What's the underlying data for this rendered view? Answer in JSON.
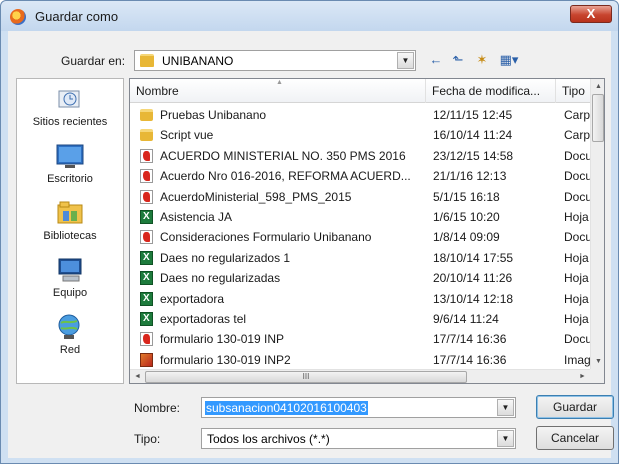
{
  "window": {
    "title": "Guardar como",
    "close_glyph": "X"
  },
  "location": {
    "label": "Guardar en:",
    "value": "UNIBANANO"
  },
  "toolbar": {
    "back_glyph": "←",
    "up_glyph": "⬑",
    "newfolder_glyph": "✶",
    "views_glyph": "▦▾"
  },
  "places": [
    {
      "label": "Sitios recientes",
      "icon": "recent-places-icon"
    },
    {
      "label": "Escritorio",
      "icon": "desktop-icon"
    },
    {
      "label": "Bibliotecas",
      "icon": "libraries-icon"
    },
    {
      "label": "Equipo",
      "icon": "computer-icon"
    },
    {
      "label": "Red",
      "icon": "network-icon"
    }
  ],
  "columns": {
    "name": "Nombre",
    "date": "Fecha de modifica...",
    "type": "Tipo"
  },
  "files": [
    {
      "name": "Pruebas Unibanano",
      "date": "12/11/15 12:45",
      "type": "Carpet",
      "icon": "folder"
    },
    {
      "name": "Script vue",
      "date": "16/10/14 11:24",
      "type": "Carpet",
      "icon": "folder"
    },
    {
      "name": "ACUERDO MINISTERIAL NO. 350 PMS 2016",
      "date": "23/12/15 14:58",
      "type": "Docun",
      "icon": "pdf"
    },
    {
      "name": "Acuerdo Nro  016-2016, REFORMA ACUERD...",
      "date": "21/1/16 12:13",
      "type": "Docun",
      "icon": "pdf"
    },
    {
      "name": "AcuerdoMinisterial_598_PMS_2015",
      "date": "5/1/15 16:18",
      "type": "Docun",
      "icon": "pdf"
    },
    {
      "name": "Asistencia JA",
      "date": "1/6/15 10:20",
      "type": "Hoja d",
      "icon": "xls"
    },
    {
      "name": "Consideraciones Formulario Unibanano",
      "date": "1/8/14 09:09",
      "type": "Docun",
      "icon": "pdf"
    },
    {
      "name": "Daes no regularizados 1",
      "date": "18/10/14 17:55",
      "type": "Hoja d",
      "icon": "xls"
    },
    {
      "name": "Daes no regularizadas",
      "date": "20/10/14 11:26",
      "type": "Hoja d",
      "icon": "xls"
    },
    {
      "name": "exportadora",
      "date": "13/10/14 12:18",
      "type": "Hoja d",
      "icon": "xls"
    },
    {
      "name": "exportadoras tel",
      "date": "9/6/14 11:24",
      "type": "Hoja d",
      "icon": "xls"
    },
    {
      "name": "formulario 130-019 INP",
      "date": "17/7/14 16:36",
      "type": "Docun",
      "icon": "pdf"
    },
    {
      "name": "formulario 130-019 INP2",
      "date": "17/7/14 16:36",
      "type": "Imager",
      "icon": "img"
    }
  ],
  "scroll": {
    "up": "▲",
    "down": "▼",
    "left": "◄",
    "right": "►",
    "grip": "III"
  },
  "filename": {
    "label": "Nombre:",
    "value": "subsanacion04102016100403"
  },
  "filetype": {
    "label": "Tipo:",
    "value": "Todos los archivos (*.*)"
  },
  "buttons": {
    "save": "Guardar",
    "cancel": "Cancelar"
  },
  "dropdown_glyph": "▼",
  "colors": {
    "selection": "#3399ff",
    "window_frame": "#cfe0f2",
    "close_button": "#c8452f"
  }
}
